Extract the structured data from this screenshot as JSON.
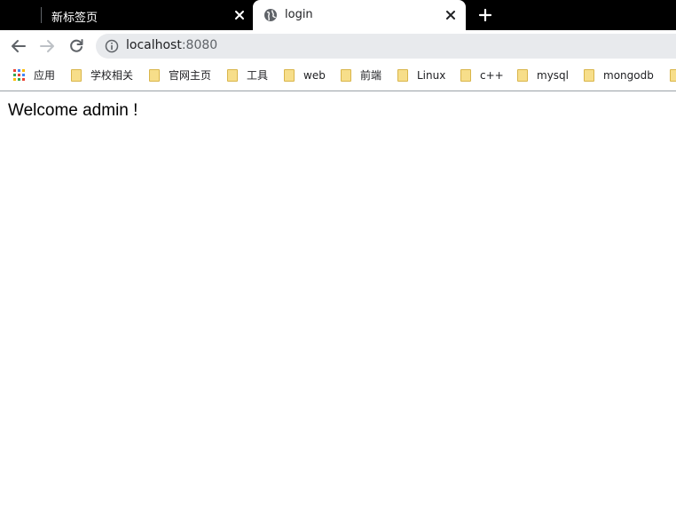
{
  "tabs": [
    {
      "title": "新标签页",
      "active": false
    },
    {
      "title": "login",
      "active": true
    }
  ],
  "toolbar": {
    "url_host": "localhost",
    "url_port": ":8080"
  },
  "bookmarks": {
    "apps_label": "应用",
    "items": [
      "学校相关",
      "官网主页",
      "工具",
      "web",
      "前端",
      "Linux",
      "c++",
      "mysql",
      "mongodb"
    ]
  },
  "page": {
    "message": "Welcome admin !"
  },
  "colors": {
    "tabbar_bg": "#000000",
    "omnibox_bg": "#e8eaed",
    "folder": "#f7de8a"
  }
}
